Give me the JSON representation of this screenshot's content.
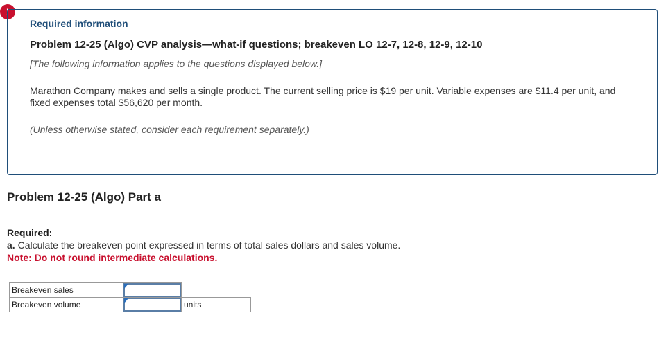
{
  "alert_icon": "!",
  "info": {
    "required_information": "Required information",
    "problem_title": "Problem 12-25 (Algo) CVP analysis—what-if questions; breakeven LO 12-7, 12-8, 12-9, 12-10",
    "applies_note": "[The following information applies to the questions displayed below.]",
    "body": "Marathon Company makes and sells a single product. The current selling price is $19 per unit. Variable expenses are $11.4 per unit, and fixed expenses total $56,620 per month.",
    "separately_note": "(Unless otherwise stated, consider each requirement separately.)"
  },
  "part": {
    "heading": "Problem 12-25 (Algo) Part a",
    "required_label": "Required:",
    "requirement_letter": "a.",
    "requirement_text": " Calculate the breakeven point expressed in terms of total sales dollars and sales volume.",
    "note": "Note: Do not round intermediate calculations."
  },
  "answer_table": {
    "rows": [
      {
        "label": "Breakeven sales",
        "value": "",
        "unit": ""
      },
      {
        "label": "Breakeven volume",
        "value": "",
        "unit": "units"
      }
    ]
  },
  "colors": {
    "accent_blue": "#1f4e79",
    "alert_red": "#c8102e"
  }
}
